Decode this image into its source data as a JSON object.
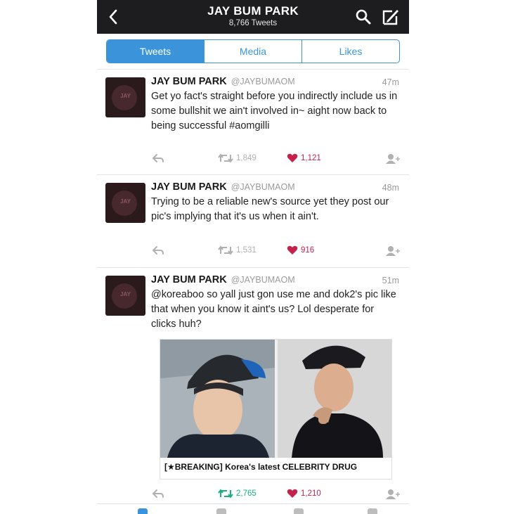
{
  "header": {
    "title": "JAY BUM PARK",
    "subtitle": "8,766 Tweets"
  },
  "tabs": [
    {
      "label": "Tweets",
      "active": true
    },
    {
      "label": "Media",
      "active": false
    },
    {
      "label": "Likes",
      "active": false
    }
  ],
  "tweets": [
    {
      "name": "JAY BUM PARK",
      "handle": "@JAYBUMAOM",
      "time": "47m",
      "text": "Get yo fact's straight before you indirectly include us in some bullshit we ain't involved in~ aight now back to being successful #aomgilli",
      "retweets": "1,849",
      "likes": "1,121"
    },
    {
      "name": "JAY BUM PARK",
      "handle": "@JAYBUMAOM",
      "time": "48m",
      "text": "Trying to be a reliable new's source yet they post our pic's implying that it's us when it ain't.",
      "retweets": "1,531",
      "likes": "916"
    },
    {
      "name": "JAY BUM PARK",
      "handle": "@JAYBUMAOM",
      "time": "51m",
      "text": "@koreaboo so yall just gon use me and dok2's pic like that when you know it aint's us? Lol desperate for clicks huh?",
      "retweets": "2,765",
      "likes": "1,210",
      "media_caption": "[★BREAKING] Korea's latest CELEBRITY DRUG"
    }
  ],
  "colors": {
    "accent": "#3b94d9",
    "retweet_active": "#19b07a",
    "like": "#c5224b",
    "header_bg": "#1d1d1f"
  },
  "icons": [
    "back-chevron-icon",
    "search-icon",
    "compose-icon",
    "reply-icon",
    "retweet-icon",
    "heart-icon",
    "follow-icon"
  ]
}
